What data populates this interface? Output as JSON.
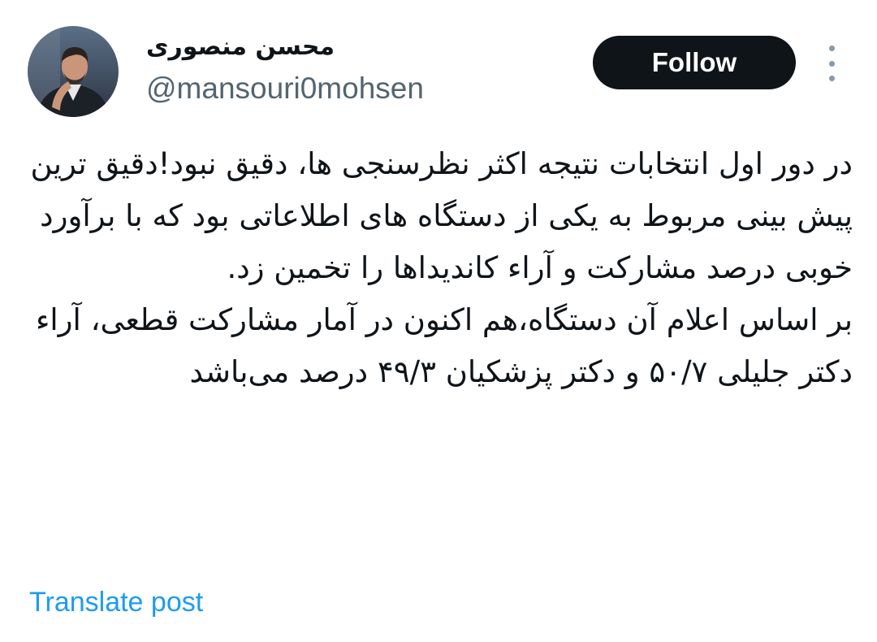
{
  "header": {
    "display_name": "محسن منصوری",
    "username": "@mansouri0mohsen",
    "follow_label": "Follow"
  },
  "post": {
    "paragraph_1": "در دور اول انتخابات نتیجه اکثر نظرسنجی ها، دقیق نبود!دقیق ترین پیش بینی مربوط به یکی از دستگاه های اطلاعاتی بود که با برآورد خوبی درصد مشارکت و آراء کاندیداها را تخمین زد.",
    "paragraph_2": "بر اساس اعلام آن دستگاه،هم اکنون در آمار مشارکت قطعی، آراء دکتر جلیلی ۵۰/۷ و دکتر پزشکیان ۴۹/۳ درصد می‌باشد"
  },
  "footer": {
    "translate_label": "Translate post"
  },
  "colors": {
    "text": "#0f1419",
    "secondary_text": "#536471",
    "link": "#1d9bf0",
    "follow_background": "#0f1419",
    "follow_text": "#ffffff"
  },
  "icons": {
    "more": "more-vertical-icon"
  }
}
